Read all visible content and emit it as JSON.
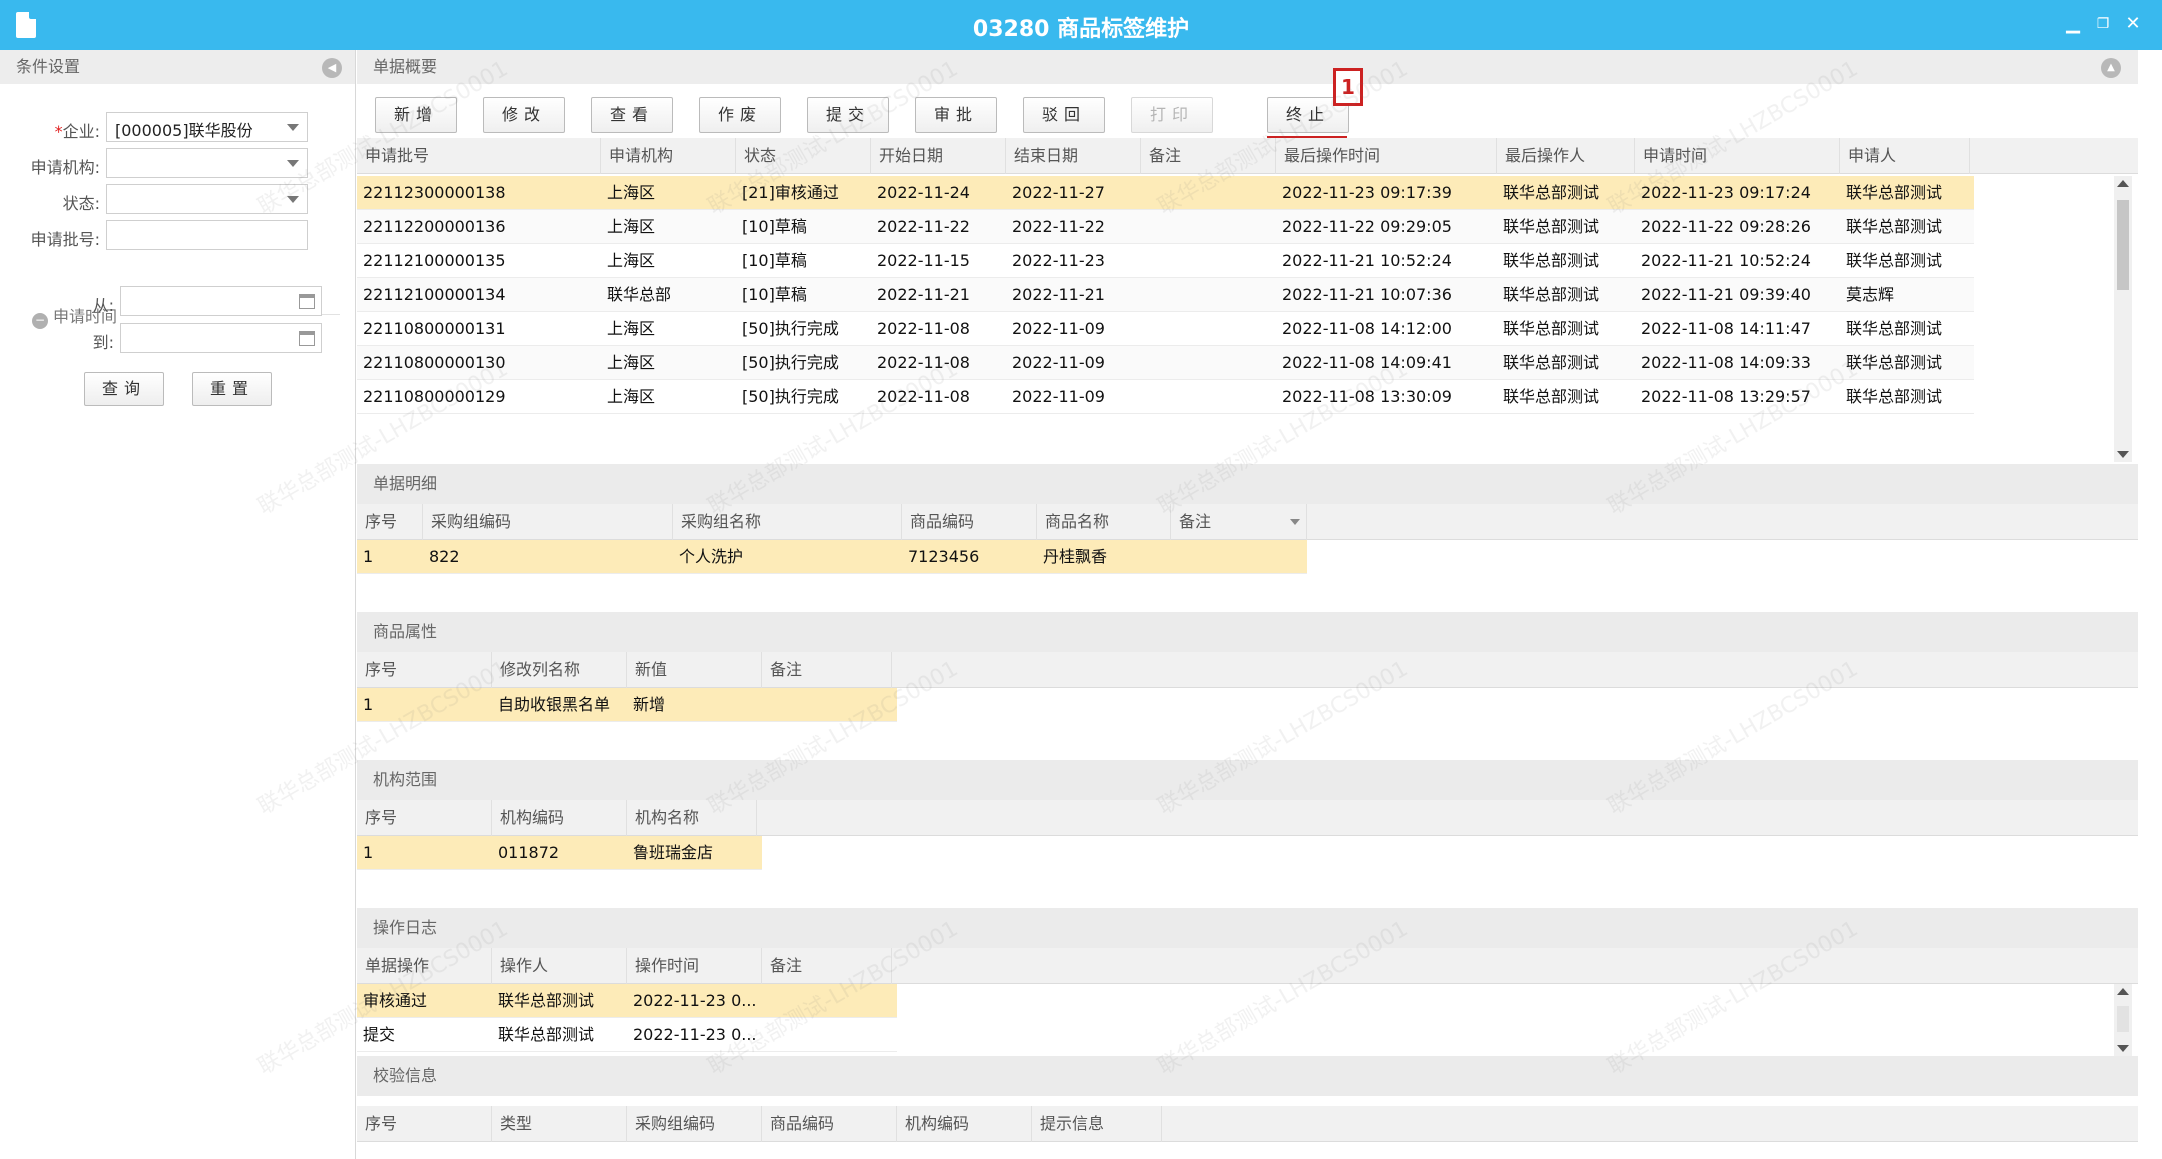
{
  "window": {
    "title": "03280 商品标签维护",
    "min_label": "▁",
    "restore_label": "❐",
    "close_label": "✕"
  },
  "left": {
    "header": "条件设置",
    "enterprise_label": "企业:",
    "enterprise_value": "[000005]联华股份",
    "org_label": "申请机构:",
    "org_value": "",
    "status_label": "状态:",
    "status_value": "",
    "batch_label": "申请批号:",
    "batch_value": "",
    "time_section": "申请时间",
    "from_label": "从:",
    "from_value": "",
    "to_label": "到:",
    "to_value": "",
    "query_btn": "查询",
    "reset_btn": "重置"
  },
  "summary": {
    "header": "单据概要",
    "toolbar": [
      "新增",
      "修改",
      "查看",
      "作废",
      "提交",
      "审批",
      "驳回",
      "打印",
      "终止"
    ],
    "callout": "1",
    "columns": [
      "申请批号",
      "申请机构",
      "状态",
      "开始日期",
      "结束日期",
      "备注",
      "最后操作时间",
      "最后操作人",
      "申请时间",
      "申请人"
    ],
    "rows": [
      [
        "22112300000138",
        "上海区",
        "[21]审核通过",
        "2022-11-24",
        "2022-11-27",
        "",
        "2022-11-23 09:17:39",
        "联华总部测试",
        "2022-11-23 09:17:24",
        "联华总部测试"
      ],
      [
        "22112200000136",
        "上海区",
        "[10]草稿",
        "2022-11-22",
        "2022-11-22",
        "",
        "2022-11-22 09:29:05",
        "联华总部测试",
        "2022-11-22 09:28:26",
        "联华总部测试"
      ],
      [
        "22112100000135",
        "上海区",
        "[10]草稿",
        "2022-11-15",
        "2022-11-23",
        "",
        "2022-11-21 10:52:24",
        "联华总部测试",
        "2022-11-21 10:52:24",
        "联华总部测试"
      ],
      [
        "22112100000134",
        "联华总部",
        "[10]草稿",
        "2022-11-21",
        "2022-11-21",
        "",
        "2022-11-21 10:07:36",
        "联华总部测试",
        "2022-11-21 09:39:40",
        "莫志辉"
      ],
      [
        "22110800000131",
        "上海区",
        "[50]执行完成",
        "2022-11-08",
        "2022-11-09",
        "",
        "2022-11-08 14:12:00",
        "联华总部测试",
        "2022-11-08 14:11:47",
        "联华总部测试"
      ],
      [
        "22110800000130",
        "上海区",
        "[50]执行完成",
        "2022-11-08",
        "2022-11-09",
        "",
        "2022-11-08 14:09:41",
        "联华总部测试",
        "2022-11-08 14:09:33",
        "联华总部测试"
      ],
      [
        "22110800000129",
        "上海区",
        "[50]执行完成",
        "2022-11-08",
        "2022-11-09",
        "",
        "2022-11-08 13:30:09",
        "联华总部测试",
        "2022-11-08 13:29:57",
        "联华总部测试"
      ]
    ]
  },
  "detail": {
    "header": "单据明细",
    "columns": [
      "序号",
      "采购组编码",
      "采购组名称",
      "商品编码",
      "商品名称",
      "备注"
    ],
    "rows": [
      [
        "1",
        "822",
        "个人洗护",
        "7123456",
        "丹桂飘香",
        ""
      ]
    ]
  },
  "attributes": {
    "header": "商品属性",
    "columns": [
      "序号",
      "修改列名称",
      "新值",
      "备注"
    ],
    "rows": [
      [
        "1",
        "自助收银黑名单",
        "新增",
        ""
      ]
    ]
  },
  "orgs": {
    "header": "机构范围",
    "columns": [
      "序号",
      "机构编码",
      "机构名称"
    ],
    "rows": [
      [
        "1",
        "011872",
        "鲁班瑞金店"
      ]
    ]
  },
  "log": {
    "header": "操作日志",
    "columns": [
      "单据操作",
      "操作人",
      "操作时间",
      "备注"
    ],
    "rows": [
      [
        "审核通过",
        "联华总部测试",
        "2022-11-23 0...",
        ""
      ],
      [
        "提交",
        "联华总部测试",
        "2022-11-23 0...",
        ""
      ]
    ]
  },
  "check": {
    "header": "校验信息",
    "columns": [
      "序号",
      "类型",
      "采购组编码",
      "商品编码",
      "机构编码",
      "提示信息"
    ]
  },
  "watermark": "联华总部测试-LHZBCS0001"
}
